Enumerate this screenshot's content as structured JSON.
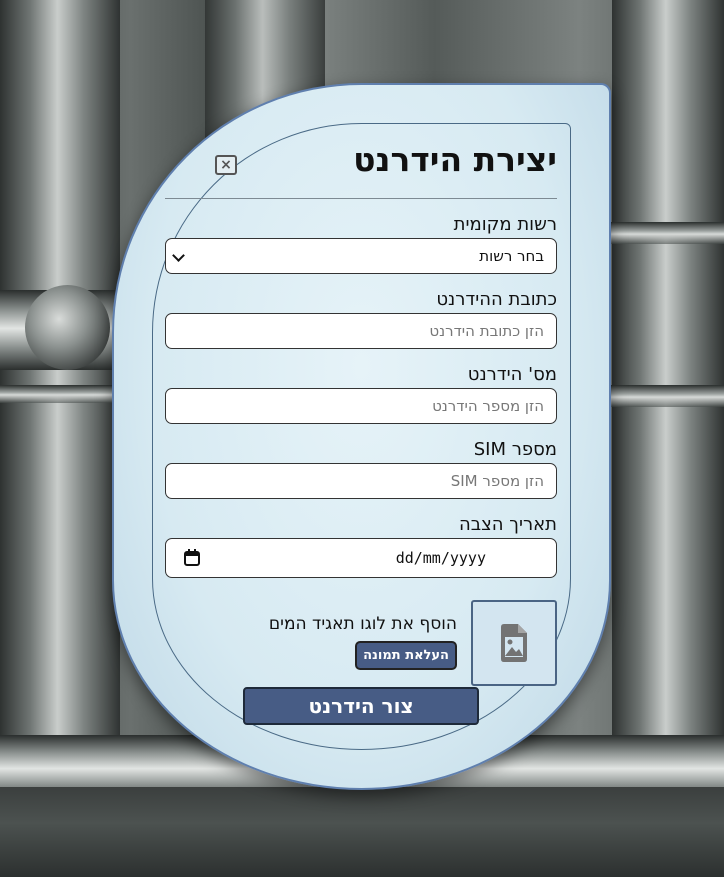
{
  "form": {
    "title": "יצירת הידרנט",
    "close_label": "×",
    "authority": {
      "label": "רשות מקומית",
      "value": "בחר רשות"
    },
    "address": {
      "label": "כתובת ההידרנט",
      "placeholder": "הזן כתובת הידרנט"
    },
    "hydrant_number": {
      "label": "מס' הידרנט",
      "placeholder": "הזן מספר הידרנט"
    },
    "sim": {
      "label": "מספר SIM",
      "placeholder": "הזן מספר SIM"
    },
    "install_date": {
      "label": "תאריך הצבה",
      "value": "dd/mm/yyyy"
    },
    "logo": {
      "label": "הוסף את לוגו תאגיד המים",
      "upload_label": "העלאת תמונה",
      "icon": "image-icon"
    },
    "submit_label": "צור הידרנט"
  },
  "colors": {
    "accent": "#475c85",
    "panel": "#d7eaf2",
    "border": "#5f7fae"
  }
}
